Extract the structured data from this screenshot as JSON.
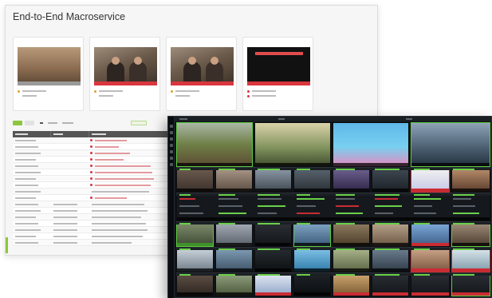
{
  "dashboard": {
    "title": "End-to-End Macroservice",
    "colors": {
      "accent": "#8dc63f",
      "alert": "#d9363e",
      "header": "#555555"
    }
  },
  "multiviewer": {
    "colors": {
      "ok": "#5ccc3c",
      "alarm": "#c92c33",
      "background": "#101418"
    }
  }
}
